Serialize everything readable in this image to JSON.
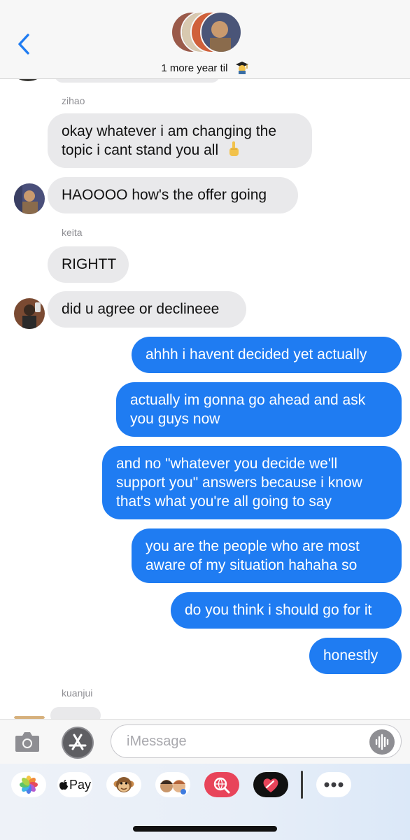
{
  "header": {
    "group_name": "1 more year til",
    "group_emoji_icon": "graduation-cap-icon"
  },
  "messages": [
    {
      "sender": "zihao"
    },
    {
      "text": "okay whatever i am changing the"
    },
    {
      "text": "topic i cant stand you all"
    },
    {
      "text": "HAOOOO how's the offer going"
    },
    {
      "sender": "keita"
    },
    {
      "text": "RIGHTT"
    },
    {
      "text": "did u agree or declineee"
    },
    {
      "text": "ahhh i havent decided yet actually"
    },
    {
      "text": "actually im gonna go ahead and ask"
    },
    {
      "text": "you guys now"
    },
    {
      "text": "and no \"whatever you decide we'll"
    },
    {
      "text": "support you\" answers because i know"
    },
    {
      "text": "that's what you're all going to say"
    },
    {
      "text": "you are the people who are most"
    },
    {
      "text": "aware of my situation hahaha so"
    },
    {
      "text": "do you think i should go for it"
    },
    {
      "text": "honestly"
    },
    {
      "sender": "kuanjui"
    }
  ],
  "composer": {
    "placeholder": "iMessage"
  },
  "apps": {
    "apple_pay_label": "Pay"
  },
  "colors": {
    "outgoing": "#1f7cf2",
    "incoming": "#e9e9eb"
  }
}
